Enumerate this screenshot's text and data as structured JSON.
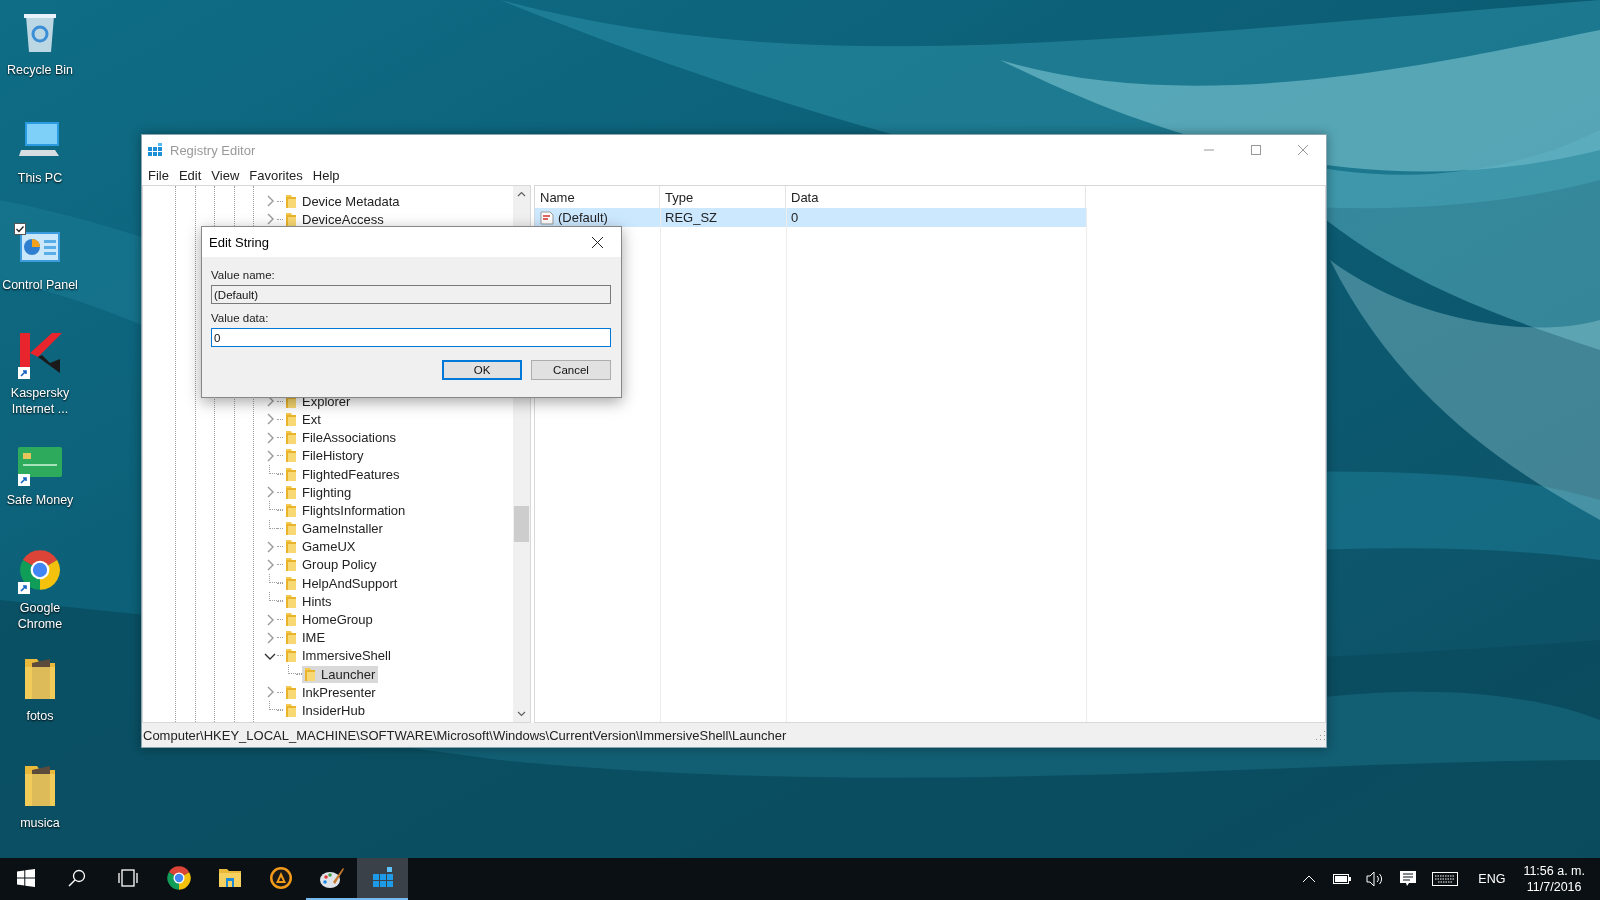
{
  "desktop_icons": [
    {
      "kind": "recycle-bin",
      "label": "Recycle Bin",
      "shortcut": false,
      "checked": false
    },
    {
      "kind": "computer",
      "label": "This PC",
      "shortcut": false,
      "checked": false
    },
    {
      "kind": "control-panel",
      "label": "Control Panel",
      "shortcut": false,
      "checked": true
    },
    {
      "kind": "antivirus",
      "label": "Kaspersky Internet ...",
      "shortcut": true,
      "checked": false
    },
    {
      "kind": "card",
      "label": "Safe Money",
      "shortcut": true,
      "checked": false
    },
    {
      "kind": "browser",
      "label": "Google Chrome",
      "shortcut": true,
      "checked": false
    },
    {
      "kind": "folder",
      "label": "fotos",
      "shortcut": false,
      "checked": false
    },
    {
      "kind": "folder",
      "label": "musica",
      "shortcut": false,
      "checked": false
    }
  ],
  "window": {
    "title": "Registry Editor",
    "menu": [
      "File",
      "Edit",
      "View",
      "Favorites",
      "Help"
    ],
    "tree": {
      "rows_top": [
        {
          "label": "Device Metadata",
          "expandable": true,
          "expanded": false,
          "selected": false
        },
        {
          "label": "DeviceAccess",
          "expandable": true,
          "expanded": false,
          "selected": false
        }
      ],
      "rows_bottom": [
        {
          "label": "Explorer",
          "expandable": true,
          "expanded": false,
          "selected": false
        },
        {
          "label": "Ext",
          "expandable": true,
          "expanded": false,
          "selected": false
        },
        {
          "label": "FileAssociations",
          "expandable": true,
          "expanded": false,
          "selected": false
        },
        {
          "label": "FileHistory",
          "expandable": true,
          "expanded": false,
          "selected": false
        },
        {
          "label": "FlightedFeatures",
          "expandable": false,
          "selected": false
        },
        {
          "label": "Flighting",
          "expandable": true,
          "expanded": false,
          "selected": false
        },
        {
          "label": "FlightsInformation",
          "expandable": false,
          "selected": false
        },
        {
          "label": "GameInstaller",
          "expandable": false,
          "selected": false
        },
        {
          "label": "GameUX",
          "expandable": true,
          "expanded": false,
          "selected": false
        },
        {
          "label": "Group Policy",
          "expandable": true,
          "expanded": false,
          "selected": false
        },
        {
          "label": "HelpAndSupport",
          "expandable": false,
          "selected": false
        },
        {
          "label": "Hints",
          "expandable": false,
          "selected": false
        },
        {
          "label": "HomeGroup",
          "expandable": true,
          "expanded": false,
          "selected": false
        },
        {
          "label": "IME",
          "expandable": true,
          "expanded": false,
          "selected": false
        },
        {
          "label": "ImmersiveShell",
          "expandable": true,
          "expanded": true,
          "selected": false,
          "children": [
            {
              "label": "Launcher",
              "expandable": false,
              "selected": true
            }
          ]
        },
        {
          "label": "InkPresenter",
          "expandable": true,
          "expanded": false,
          "selected": false
        },
        {
          "label": "InsiderHub",
          "expandable": false,
          "selected": false
        }
      ]
    },
    "list": {
      "columns": [
        "Name",
        "Type",
        "Data"
      ],
      "rows": [
        {
          "name": "(Default)",
          "type": "REG_SZ",
          "data": "0",
          "selected": true
        }
      ]
    },
    "status_bar": "Computer\\HKEY_LOCAL_MACHINE\\SOFTWARE\\Microsoft\\Windows\\CurrentVersion\\ImmersiveShell\\Launcher"
  },
  "dialog": {
    "title": "Edit String",
    "fields": [
      {
        "label": "Value name:",
        "value": "(Default)",
        "readonly": true,
        "focused": false
      },
      {
        "label": "Value data:",
        "value": "0",
        "readonly": false,
        "focused": true
      }
    ],
    "buttons": [
      {
        "label": "OK",
        "default": true
      },
      {
        "label": "Cancel",
        "default": false
      }
    ]
  },
  "taskbar": {
    "apps": [
      {
        "kind": "start",
        "running": false,
        "selected": false
      },
      {
        "kind": "search",
        "running": false,
        "selected": false
      },
      {
        "kind": "task-view",
        "running": false,
        "selected": false
      },
      {
        "kind": "browser",
        "running": false,
        "selected": false
      },
      {
        "kind": "explorer",
        "running": false,
        "selected": false
      },
      {
        "kind": "player",
        "running": false,
        "selected": false
      },
      {
        "kind": "paint",
        "running": true,
        "selected": false
      },
      {
        "kind": "registry",
        "running": true,
        "selected": true
      }
    ],
    "language": "ENG",
    "time": "11:56 a. m.",
    "date": "11/7/2016"
  }
}
